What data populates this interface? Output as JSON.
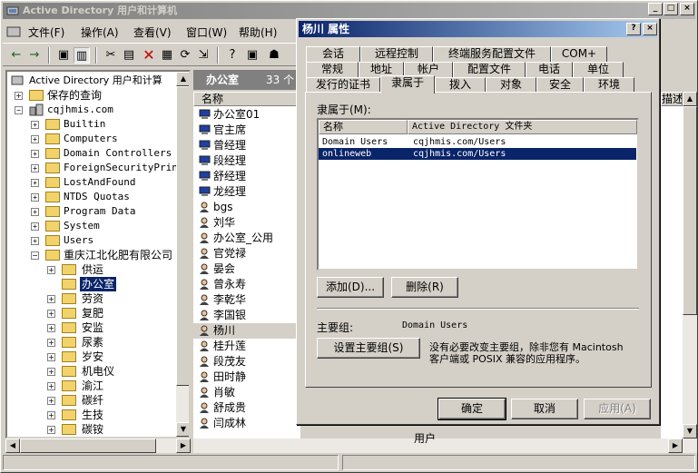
{
  "main_window": {
    "title": "Active Directory 用户和计算机",
    "controls": [
      "_",
      "□",
      "×"
    ]
  },
  "menu": [
    "文件(F)",
    "操作(A)",
    "查看(V)",
    "窗口(W)",
    "帮助(H)"
  ],
  "tree": {
    "root": "Active Directory 用户和计算",
    "saved_queries": "保存的查询",
    "domain": "cqjhmis.com",
    "items": [
      "Builtin",
      "Computers",
      "Domain Controllers",
      "ForeignSecurityPrinci",
      "LostAndFound",
      "NTDS Quotas",
      "Program Data",
      "System",
      "Users"
    ],
    "ou": "重庆江北化肥有限公司",
    "sub_ous": [
      "供运",
      "办公室",
      "劳资",
      "复肥",
      "安监",
      "尿素",
      "岁安",
      "机电仪",
      "渝江",
      "碳纤",
      "生技",
      "碳铵"
    ],
    "selected": "办公室"
  },
  "right_pane": {
    "title": "办公室",
    "count": "33 个",
    "column": "名称",
    "rows": [
      "办公室01",
      "官主席",
      "曾经理",
      "段经理",
      "舒经理",
      "龙经理",
      "bgs",
      "刘华",
      "办公室_公用",
      "官党禄",
      "晏会",
      "曾永寿",
      "李乾华",
      "李国银",
      "杨川",
      "桂升莲",
      "段茂友",
      "田时静",
      "肖敏",
      "舒成贵",
      "闫成林"
    ],
    "computer_rows": 6,
    "selected": "杨川",
    "desc_col": "描述",
    "partial_right": "用户"
  },
  "dialog": {
    "title": "杨川 属性",
    "help": "?",
    "close": "×",
    "tabs_row1": [
      "会话",
      "远程控制",
      "终端服务配置文件",
      "COM+"
    ],
    "tabs_row2": [
      "常规",
      "地址",
      "帐户",
      "配置文件",
      "电话",
      "单位"
    ],
    "tabs_row3": [
      "发行的证书",
      "隶属于",
      "拨入",
      "对象",
      "安全",
      "环境"
    ],
    "active_tab": "隶属于",
    "member_of_label": "隶属于(M):",
    "columns": [
      "名称",
      "Active Directory 文件夹"
    ],
    "groups": [
      {
        "name": "Domain Users",
        "folder": "cqjhmis.com/Users"
      },
      {
        "name": "onlineweb",
        "folder": "cqjhmis.com/Users"
      }
    ],
    "selected_group": "onlineweb",
    "add_button": "添加(D)...",
    "remove_button": "删除(R)",
    "primary_group_label": "主要组:",
    "primary_group_value": "Domain Users",
    "set_primary_button": "设置主要组(S)",
    "note_line1": "没有必要改变主要组，除非您有 Macintosh",
    "note_line2": "客户端或 POSIX 兼容的应用程序。",
    "ok": "确定",
    "cancel": "取消",
    "apply": "应用(A)"
  }
}
